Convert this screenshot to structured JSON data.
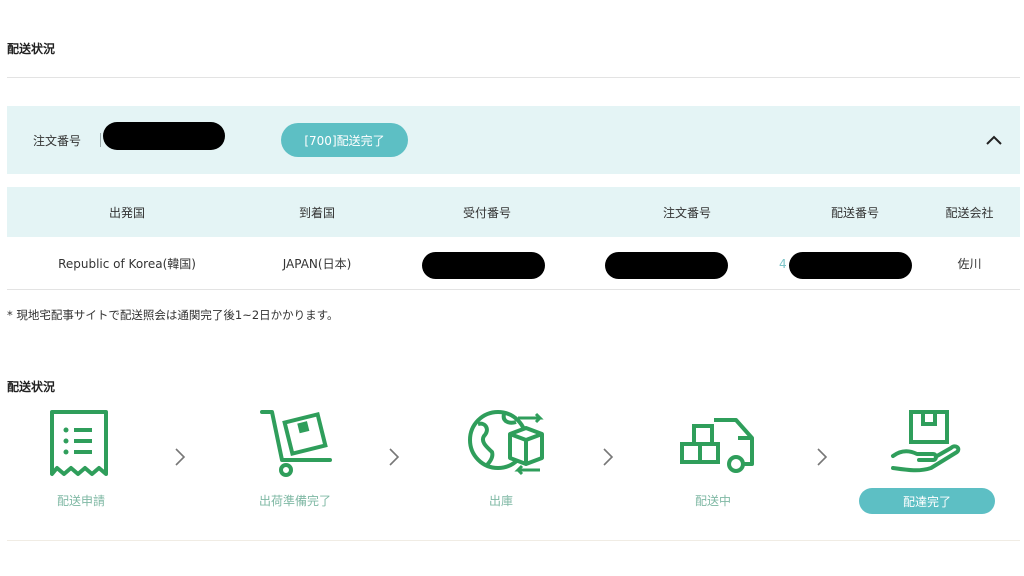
{
  "page": {
    "title": "配送状況"
  },
  "order": {
    "label": "注文番号",
    "status_badge": "[700]配送完了",
    "collapse_icon": "chevron-up-icon"
  },
  "table": {
    "headers": [
      "出発国",
      "到着国",
      "受付番号",
      "注文番号",
      "配送番号",
      "配送会社"
    ],
    "row": {
      "origin": "Republic of Korea(韓国)",
      "destination": "JAPAN(日本)",
      "tracking_prefix": "4",
      "carrier": "佐川"
    }
  },
  "note": "* 現地宅配事サイトで配送照会は通関完了後1~2日かかります。",
  "status_section": {
    "title": "配送状況",
    "steps": [
      {
        "label": "配送申請",
        "icon": "receipt-icon"
      },
      {
        "label": "出荷準備完了",
        "icon": "cart-box-icon"
      },
      {
        "label": "出庫",
        "icon": "globe-box-icon"
      },
      {
        "label": "配送中",
        "icon": "truck-icon"
      },
      {
        "label": "配達完了",
        "icon": "hand-box-icon",
        "active": true
      }
    ]
  },
  "colors": {
    "accent": "#5dbfc4",
    "icon_green": "#2f9e5b",
    "header_bg": "#e4f4f5"
  }
}
